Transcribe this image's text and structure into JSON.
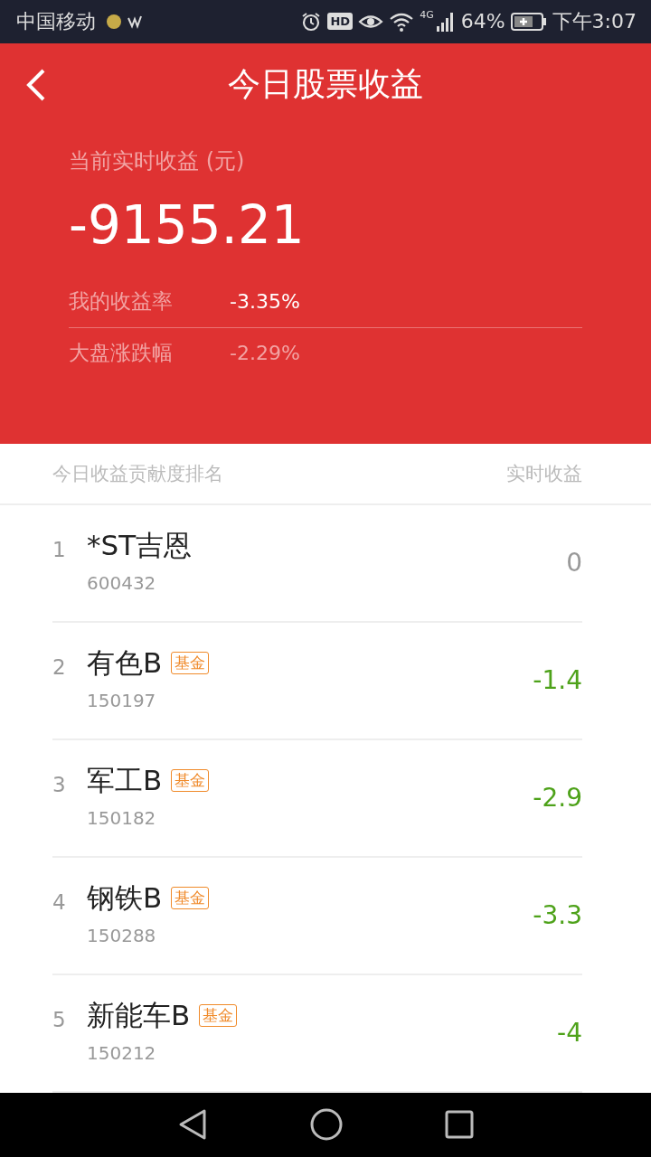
{
  "status_bar": {
    "carrier": "中国移动",
    "network": "4G",
    "hd": "HD",
    "battery": "64%",
    "time": "下午3:07"
  },
  "header": {
    "title": "今日股票收益",
    "label": "当前实时收益 (元)",
    "value": "-9155.21",
    "stats": [
      {
        "label": "我的收益率",
        "value": "-3.35%",
        "highlight": true
      },
      {
        "label": "大盘涨跌幅",
        "value": "-2.29%",
        "highlight": false
      }
    ]
  },
  "list": {
    "heading": "今日收益贡献度排名",
    "column": "实时收益",
    "rows": [
      {
        "rank": "1",
        "name": "*ST吉恩",
        "code": "600432",
        "value": "0",
        "color": "#999999"
      },
      {
        "rank": "2",
        "name": "有色B",
        "tag": "基金",
        "code": "150197",
        "value": "-1.4",
        "color": "#4ea21a"
      },
      {
        "rank": "3",
        "name": "军工B",
        "tag": "基金",
        "code": "150182",
        "value": "-2.9",
        "color": "#4ea21a"
      },
      {
        "rank": "4",
        "name": "钢铁B",
        "tag": "基金",
        "code": "150288",
        "value": "-3.3",
        "color": "#4ea21a"
      },
      {
        "rank": "5",
        "name": "新能车B",
        "tag": "基金",
        "code": "150212",
        "value": "-4",
        "color": "#4ea21a"
      }
    ]
  }
}
